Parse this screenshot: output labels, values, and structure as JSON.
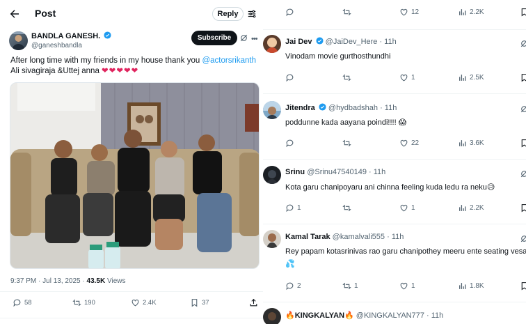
{
  "left_panel": {
    "header": {
      "title": "Post",
      "reply_label": "Reply"
    },
    "author": {
      "name": "BANDLA GANESH.",
      "handle": "@ganeshbandla",
      "subscribe_label": "Subscribe"
    },
    "tweet": {
      "text_before": "After long time with my friends in my house thank you ",
      "mention": "@actorsrikanth",
      "text_after": " Ali sivagiraja &Uttej anna ",
      "hearts": "❤❤❤❤❤"
    },
    "meta": {
      "time_date": "9:37 PM · Jul 13, 2025 · ",
      "views_count": "43.5K",
      "views_label": " Views"
    },
    "actions": {
      "replies": "58",
      "retweets": "190",
      "likes": "2.4K",
      "bookmarks": "37"
    }
  },
  "right_panel": {
    "top_actions": {
      "likes": "12",
      "views": "2.2K"
    },
    "replies": [
      {
        "name": "Jai Dev",
        "handle": "@JaiDev_Here · 11h",
        "text": "Vinodam movie gurthosthundhi",
        "retweets": "",
        "likes": "1",
        "views": "2.5K",
        "comments": ""
      },
      {
        "name": "Jitendra",
        "handle": "@hydbadshah · 11h",
        "text": "poddunne kada aayana poindi!!!!",
        "emoji": "😱",
        "retweets": "",
        "likes": "22",
        "views": "3.6K",
        "comments": ""
      },
      {
        "name": "Srinu",
        "handle": "@Srinu47540149 · 11h",
        "text": "Kota garu chanipoyaru ani chinna feeling kuda ledu ra neku",
        "emoji": "😥",
        "comments": "1",
        "retweets": "",
        "likes": "1",
        "views": "2.2K"
      },
      {
        "name": "Kamal Tarak",
        "handle": "@kamalvali555 · 11h",
        "text": "Rey papam kotasrinivas rao garu chanipothey meeru ente seating vesar",
        "text2": "💦",
        "comments": "2",
        "retweets": "1",
        "likes": "1",
        "views": "1.8K"
      },
      {
        "name_prefix": "🔥",
        "name": "KINGKALYAN",
        "name_suffix": "🔥",
        "handle": "@KINGKALYAN777 · 11h"
      }
    ]
  },
  "colors": {
    "accent": "#1d9bf0",
    "text": "#0f1419",
    "muted": "#536471",
    "heart": "#e0245e"
  }
}
